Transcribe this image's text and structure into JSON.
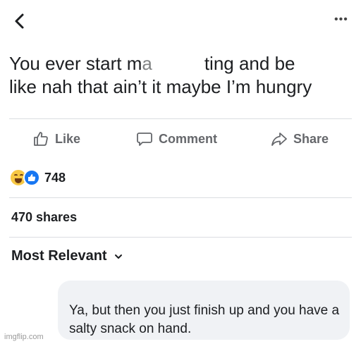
{
  "header": {
    "back_icon": "chevron-left-icon",
    "more_icon": "ellipsis-icon",
    "more_label": "•••"
  },
  "post": {
    "text_left": "You ever start m",
    "text_left_partial": "a",
    "text_right": "ting and be",
    "text_line2": "like nah that ain’t it maybe I’m hungry"
  },
  "actions": {
    "like_label": "Like",
    "comment_label": "Comment",
    "share_label": "Share"
  },
  "reactions": {
    "count": "748"
  },
  "shares": {
    "label": "470 shares"
  },
  "comments": {
    "sort_label": "Most Relevant",
    "items": [
      {
        "text": "Ya, but then you just finish up and you have a salty snack on hand."
      }
    ]
  },
  "watermark": "imgflip.com",
  "colors": {
    "text": "#1c1e21",
    "muted": "#65676b",
    "bubble": "#f0f2f5",
    "like_blue": "#1877f2",
    "haha_yellow": "#f7c844"
  }
}
